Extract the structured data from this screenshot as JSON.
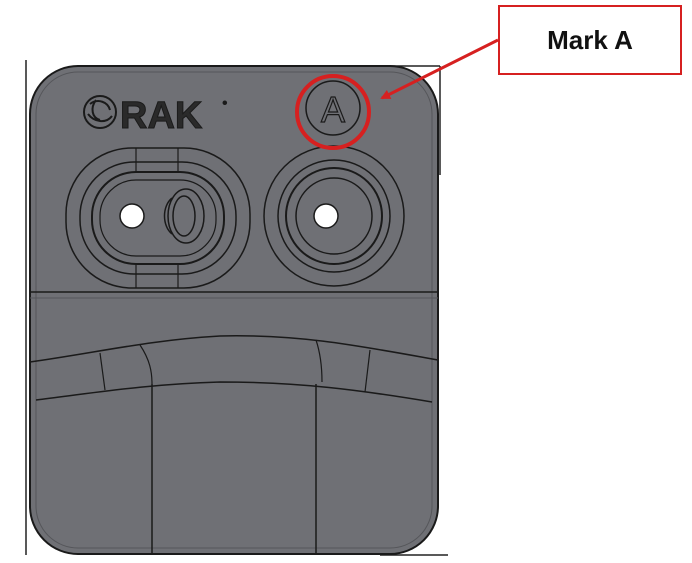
{
  "callout": {
    "label": "Mark A",
    "color": "#d62020"
  },
  "device": {
    "brand": "RAK",
    "brand_mark": "•",
    "marking_letter": "A",
    "body_color": "#6f7075",
    "line_color": "#1a1a1a"
  }
}
